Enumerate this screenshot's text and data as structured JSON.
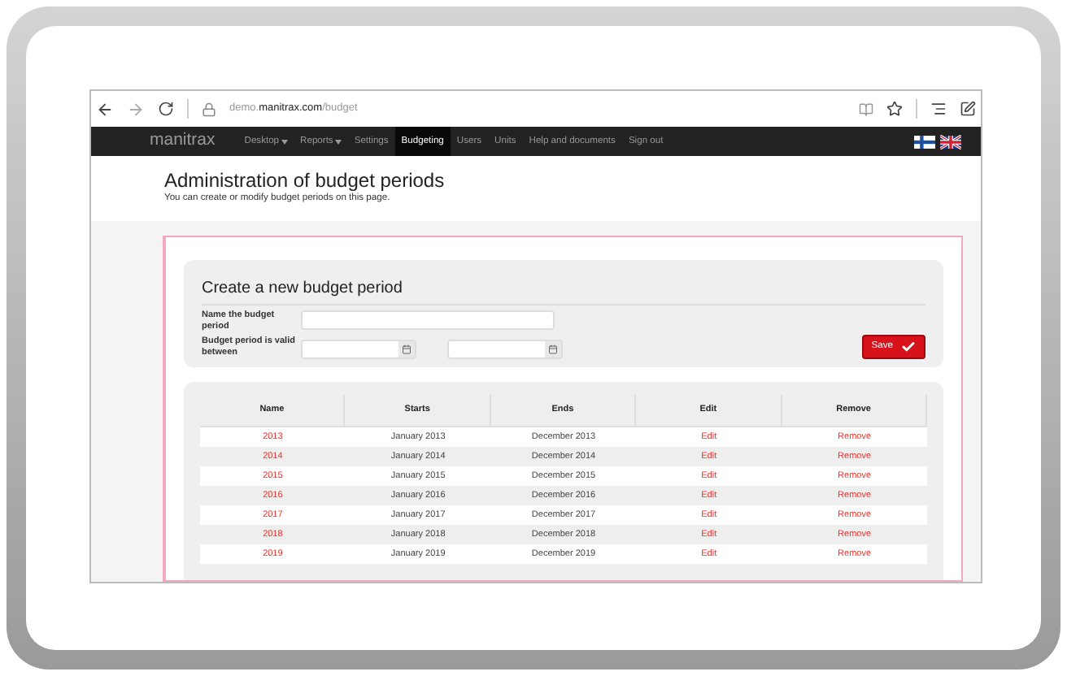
{
  "browser": {
    "url_host": "demo.",
    "url_domain": "manitrax.com",
    "url_path": "/budget"
  },
  "nav": {
    "logo": "manitrax",
    "items": [
      {
        "label": "Desktop",
        "dropdown": true,
        "selected": false
      },
      {
        "label": "Reports",
        "dropdown": true,
        "selected": false
      },
      {
        "label": "Settings",
        "dropdown": false,
        "selected": false
      },
      {
        "label": "Budgeting",
        "dropdown": false,
        "selected": true
      },
      {
        "label": "Users",
        "dropdown": false,
        "selected": false
      },
      {
        "label": "Units",
        "dropdown": false,
        "selected": false
      },
      {
        "label": "Help and documents",
        "dropdown": false,
        "selected": false
      },
      {
        "label": "Sign out",
        "dropdown": false,
        "selected": false
      }
    ]
  },
  "page": {
    "title": "Administration of budget periods",
    "subtitle": "You can create or modify budget periods on this page."
  },
  "form": {
    "title": "Create a new budget period",
    "name_label": "Name the budget period",
    "valid_label": "Budget period is valid between",
    "save": "Save"
  },
  "table": {
    "columns": [
      "Name",
      "Starts",
      "Ends",
      "Edit",
      "Remove"
    ],
    "rows": [
      {
        "name": "2013",
        "starts": "January 2013",
        "ends": "December 2013",
        "edit": "Edit",
        "remove": "Remove"
      },
      {
        "name": "2014",
        "starts": "January 2014",
        "ends": "December 2014",
        "edit": "Edit",
        "remove": "Remove"
      },
      {
        "name": "2015",
        "starts": "January 2015",
        "ends": "December 2015",
        "edit": "Edit",
        "remove": "Remove"
      },
      {
        "name": "2016",
        "starts": "January 2016",
        "ends": "December 2016",
        "edit": "Edit",
        "remove": "Remove"
      },
      {
        "name": "2017",
        "starts": "January 2017",
        "ends": "December 2017",
        "edit": "Edit",
        "remove": "Remove"
      },
      {
        "name": "2018",
        "starts": "January 2018",
        "ends": "December 2018",
        "edit": "Edit",
        "remove": "Remove"
      },
      {
        "name": "2019",
        "starts": "January 2019",
        "ends": "December 2019",
        "edit": "Edit",
        "remove": "Remove"
      }
    ]
  }
}
